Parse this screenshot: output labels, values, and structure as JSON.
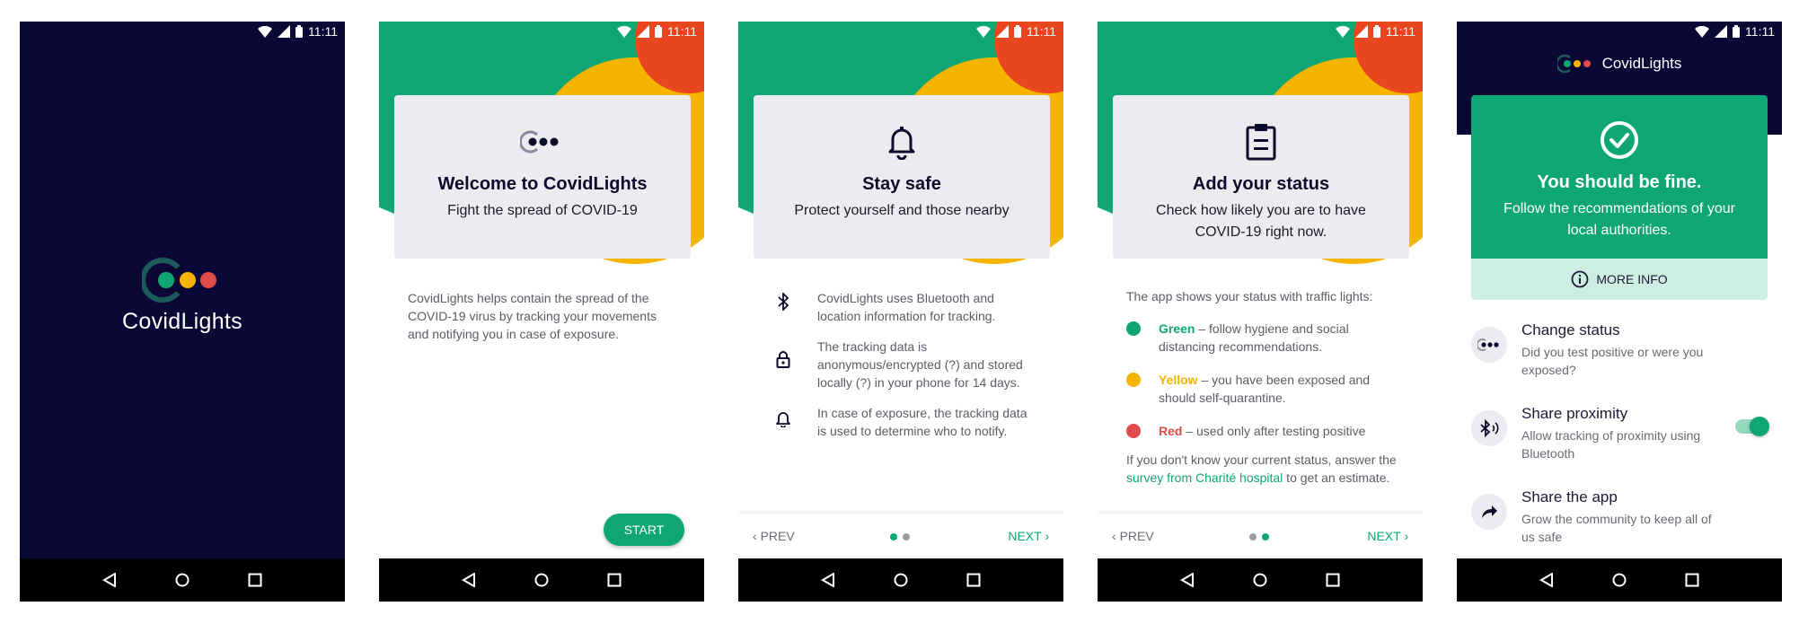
{
  "status_bar": {
    "time": "11:11"
  },
  "splash": {
    "app_name": "CovidLights"
  },
  "welcome": {
    "title": "Welcome to CovidLights",
    "subtitle": "Fight the spread of COVID-19",
    "description": "CovidLights helps contain the spread of the COVID-19 virus by tracking your movements and notifying you in case of exposure.",
    "start_label": "START"
  },
  "stay_safe": {
    "title": "Stay safe",
    "subtitle": "Protect yourself and those nearby",
    "features": [
      {
        "icon": "bluetooth-icon",
        "text": "CovidLights uses Bluetooth and location information for tracking."
      },
      {
        "icon": "lock-icon",
        "text": "The tracking data is anonymous/encrypted (?) and stored locally (?) in your phone for 14 days."
      },
      {
        "icon": "bell-icon",
        "text": "In case of exposure, the tracking data is used to determine who to notify."
      }
    ],
    "prev_label": "PREV",
    "next_label": "NEXT"
  },
  "add_status": {
    "title": "Add your status",
    "subtitle": "Check how likely you are to have COVID-19 right now.",
    "lead": "The app shows your status with traffic lights:",
    "lights": [
      {
        "color_name": "Green",
        "text": " – follow hygiene and social distancing recommendations.",
        "color": "#0ea673"
      },
      {
        "color_name": "Yellow",
        "text": " – you have been exposed and should self-quarantine.",
        "color": "#f4b400"
      },
      {
        "color_name": "Red",
        "text": " – used only after testing positive",
        "color": "#e04b4b"
      }
    ],
    "survey_pre": "If you don't know your current status, answer the ",
    "survey_link": "survey from Charité hospital",
    "survey_post": " to get an estimate.",
    "prev_label": "PREV",
    "next_label": "NEXT"
  },
  "status_screen": {
    "brand": "CovidLights",
    "title": "You should be fine.",
    "subtitle": "Follow the recommendations of your local authorities.",
    "more_info": "MORE INFO",
    "actions": [
      {
        "title": "Change status",
        "desc": "Did you test positive or were you exposed?"
      },
      {
        "title": "Share proximity",
        "desc": "Allow tracking of proximity using Bluetooth",
        "toggle_on": true
      },
      {
        "title": "Share the app",
        "desc": "Grow the community to keep all of us safe"
      }
    ]
  },
  "colors": {
    "brand_green": "#0ea673",
    "brand_yellow": "#f4b400",
    "brand_red": "#e04b4b",
    "navy": "#0b0835"
  }
}
